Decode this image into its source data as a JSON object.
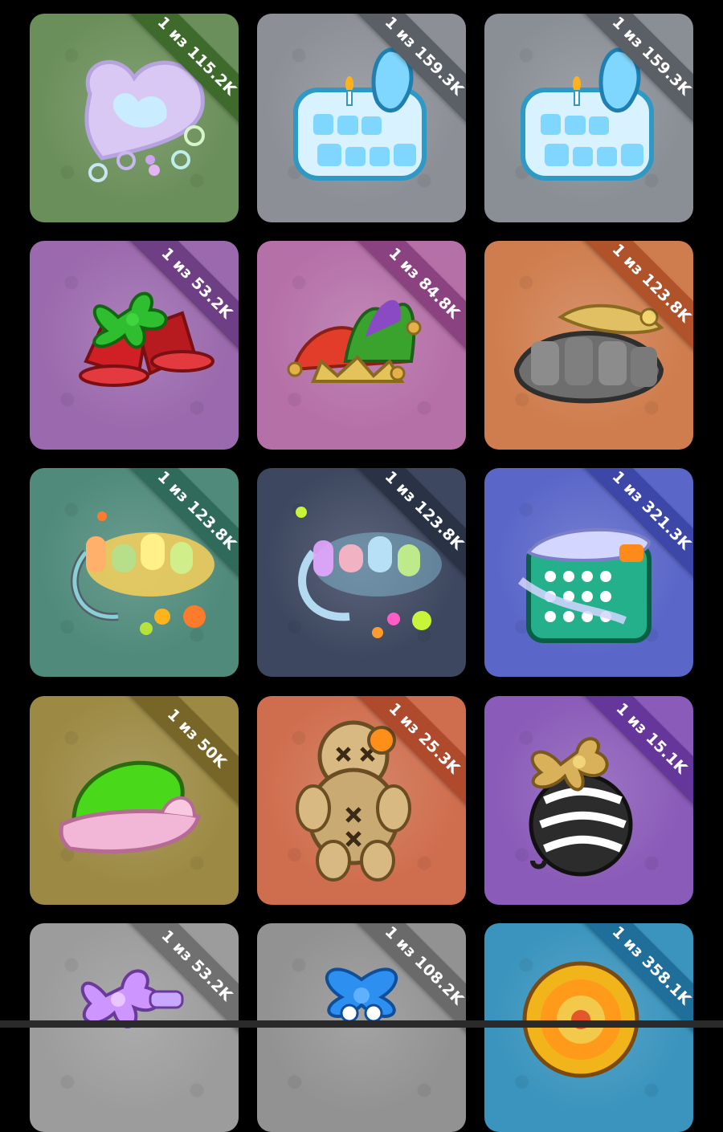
{
  "cards": [
    {
      "rarity_label": "1 из 115.2K",
      "bg": "#6b8f5a",
      "ribbon": "#3e6a2c",
      "icon": "bubble-heart-icon"
    },
    {
      "rarity_label": "1 из 159.3K",
      "bg": "#8c9096",
      "ribbon": "#5b5f66",
      "icon": "happy-bday-icon"
    },
    {
      "rarity_label": "1 из 159.3K",
      "bg": "#8a8f96",
      "ribbon": "#5b5f66",
      "icon": "happy-bday-icon"
    },
    {
      "rarity_label": "1 из 53.2K",
      "bg": "#9b69ad",
      "ribbon": "#6f3f86",
      "icon": "christmas-bells-icon"
    },
    {
      "rarity_label": "1 из 84.8K",
      "bg": "#b570a8",
      "ribbon": "#8a4380",
      "icon": "jester-hat-icon"
    },
    {
      "rarity_label": "1 из 123.8K",
      "bg": "#cf7d4e",
      "ribbon": "#b0532a",
      "icon": "2025-stone-icon"
    },
    {
      "rarity_label": "1 из 123.8K",
      "bg": "#4f8a7a",
      "ribbon": "#2f6a5a",
      "icon": "jelly-text-icon"
    },
    {
      "rarity_label": "1 из 123.8K",
      "bg": "#3d475f",
      "ribbon": "#2a3246",
      "icon": "jelly-text-icon"
    },
    {
      "rarity_label": "1 из 321.3K",
      "bg": "#5a66c8",
      "ribbon": "#3d47a8",
      "icon": "calendar-icon"
    },
    {
      "rarity_label": "1 из 50K",
      "bg": "#9c8a44",
      "ribbon": "#776628",
      "icon": "santa-hat-icon"
    },
    {
      "rarity_label": "1 из 25.3K",
      "bg": "#cf6e4e",
      "ribbon": "#b04a2d",
      "icon": "voodoo-doll-icon"
    },
    {
      "rarity_label": "1 из 15.1K",
      "bg": "#8a5bb8",
      "ribbon": "#65379a",
      "icon": "zebra-bell-icon"
    },
    {
      "rarity_label": "1 из 53.2K",
      "bg": "#9c9c9c",
      "ribbon": "#707070",
      "icon": "gift-bow-icon"
    },
    {
      "rarity_label": "1 из 108.2K",
      "bg": "#929292",
      "ribbon": "#6a6a6a",
      "icon": "blue-bow-icon"
    },
    {
      "rarity_label": "1 из 358.1K",
      "bg": "#3a94bd",
      "ribbon": "#1f6f9a",
      "icon": "lollipop-icon"
    }
  ]
}
